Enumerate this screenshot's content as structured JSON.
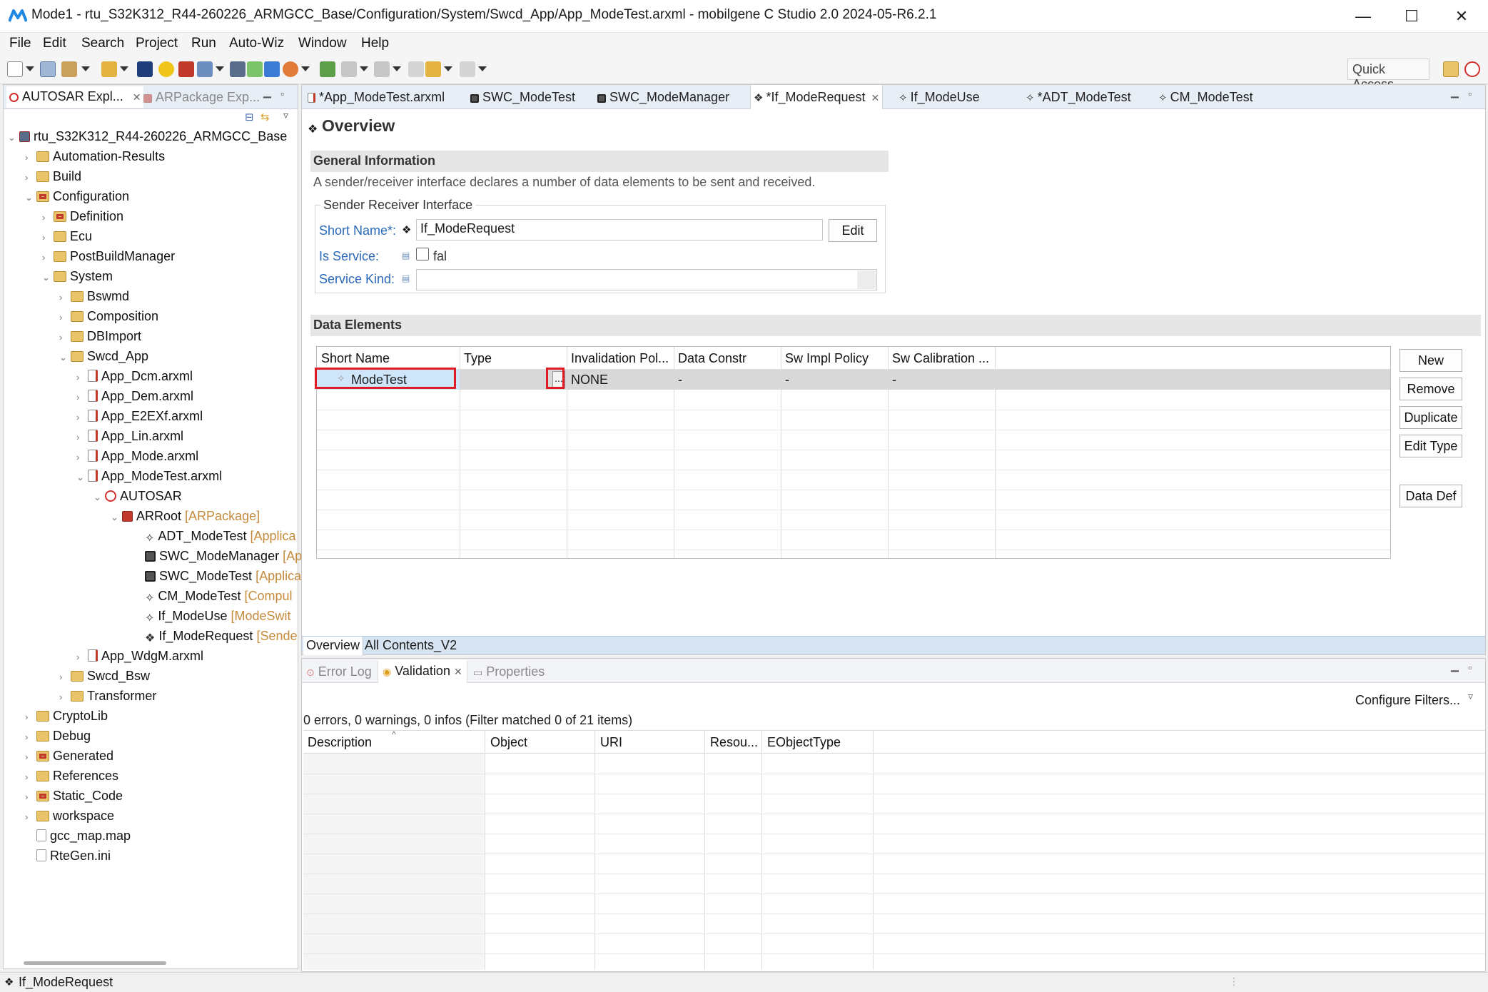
{
  "window": {
    "title": "Mode1 - rtu_S32K312_R44-260226_ARMGCC_Base/Configuration/System/Swcd_App/App_ModeTest.arxml - mobilgene C Studio 2.0 2024-05-R6.2.1",
    "minimize": "—",
    "maximize": "☐",
    "close": "✕"
  },
  "menu": [
    "File",
    "Edit",
    "Search",
    "Project",
    "Run",
    "Auto-Wiz",
    "Window",
    "Help"
  ],
  "toolbar": {
    "quick_access": "Quick Access"
  },
  "left_panel": {
    "tabs": [
      {
        "label": "AUTOSAR Expl...",
        "close": "✕"
      },
      {
        "label": "ARPackage Exp..."
      }
    ],
    "tree": [
      {
        "label": "rtu_S32K312_R44-260226_ARMGCC_Base",
        "tag": ""
      },
      {
        "label": "Automation-Results",
        "tag": ""
      },
      {
        "label": "Build",
        "tag": ""
      },
      {
        "label": "Configuration",
        "tag": ""
      },
      {
        "label": "Definition",
        "tag": ""
      },
      {
        "label": "Ecu",
        "tag": ""
      },
      {
        "label": "PostBuildManager",
        "tag": ""
      },
      {
        "label": "System",
        "tag": ""
      },
      {
        "label": "Bswmd",
        "tag": ""
      },
      {
        "label": "Composition",
        "tag": ""
      },
      {
        "label": "DBImport",
        "tag": ""
      },
      {
        "label": "Swcd_App",
        "tag": ""
      },
      {
        "label": "App_Dcm.arxml",
        "tag": ""
      },
      {
        "label": "App_Dem.arxml",
        "tag": ""
      },
      {
        "label": "App_E2EXf.arxml",
        "tag": ""
      },
      {
        "label": "App_Lin.arxml",
        "tag": ""
      },
      {
        "label": "App_Mode.arxml",
        "tag": ""
      },
      {
        "label": "App_ModeTest.arxml",
        "tag": ""
      },
      {
        "label": "AUTOSAR",
        "tag": ""
      },
      {
        "label": "ARRoot",
        "tag": "[ARPackage]"
      },
      {
        "label": "ADT_ModeTest",
        "tag": "[Applica"
      },
      {
        "label": "SWC_ModeManager",
        "tag": "[Ap"
      },
      {
        "label": "SWC_ModeTest",
        "tag": "[Applica"
      },
      {
        "label": "CM_ModeTest",
        "tag": "[Compul"
      },
      {
        "label": "If_ModeUse",
        "tag": "[ModeSwit"
      },
      {
        "label": "If_ModeRequest",
        "tag": "[Sende"
      },
      {
        "label": "App_WdgM.arxml",
        "tag": ""
      },
      {
        "label": "Swcd_Bsw",
        "tag": ""
      },
      {
        "label": "Transformer",
        "tag": ""
      },
      {
        "label": "CryptoLib",
        "tag": ""
      },
      {
        "label": "Debug",
        "tag": ""
      },
      {
        "label": "Generated",
        "tag": ""
      },
      {
        "label": "References",
        "tag": ""
      },
      {
        "label": "Static_Code",
        "tag": ""
      },
      {
        "label": "workspace",
        "tag": ""
      },
      {
        "label": "gcc_map.map",
        "tag": ""
      },
      {
        "label": "RteGen.ini",
        "tag": ""
      }
    ]
  },
  "editor": {
    "tabs": [
      "*App_ModeTest.arxml",
      "SWC_ModeTest",
      "SWC_ModeManager",
      "*If_ModeRequest",
      "If_ModeUse",
      "*ADT_ModeTest",
      "CM_ModeTest"
    ],
    "active_tab_close": "✕",
    "page_title": "Overview",
    "general": {
      "header": "General Information",
      "description": "A sender/receiver interface declares a number of data elements to be sent and received.",
      "group_label": "Sender Receiver Interface",
      "short_name_label": "Short Name*:",
      "short_name_value": "If_ModeRequest",
      "edit_button": "Edit",
      "is_service_label": "Is Service:",
      "is_service_value": "fal",
      "service_kind_label": "Service Kind:",
      "service_kind_value": ""
    },
    "data_elements": {
      "header": "Data Elements",
      "columns": [
        "Short Name",
        "Type",
        "Invalidation Pol...",
        "Data Constr",
        "Sw Impl Policy",
        "Sw Calibration ..."
      ],
      "rows": [
        {
          "short_name": "ModeTest",
          "type": "",
          "type_button": "...",
          "invalidation": "NONE",
          "data_constr": "-",
          "sw_impl": "-",
          "sw_calib": "-"
        }
      ],
      "buttons": [
        "New",
        "Remove",
        "Duplicate",
        "Edit Type",
        "Data Def"
      ]
    },
    "bottom_tabs": [
      "Overview",
      "All Contents_V2"
    ]
  },
  "bottom_panel": {
    "tabs": [
      {
        "label": "Error Log"
      },
      {
        "label": "Validation",
        "close": "✕"
      },
      {
        "label": "Properties"
      }
    ],
    "configure_filters": "Configure Filters...",
    "summary": "0 errors, 0 warnings, 0 infos (Filter matched 0 of 21 items)",
    "columns": [
      "Description",
      "Object",
      "URI",
      "Resou...",
      "EObjectType"
    ]
  },
  "status_bar": {
    "text": "If_ModeRequest"
  },
  "colors": {
    "link_blue": "#2a68b8",
    "highlight_red": "#e01b24",
    "selection_blue": "#cfe6fa"
  }
}
